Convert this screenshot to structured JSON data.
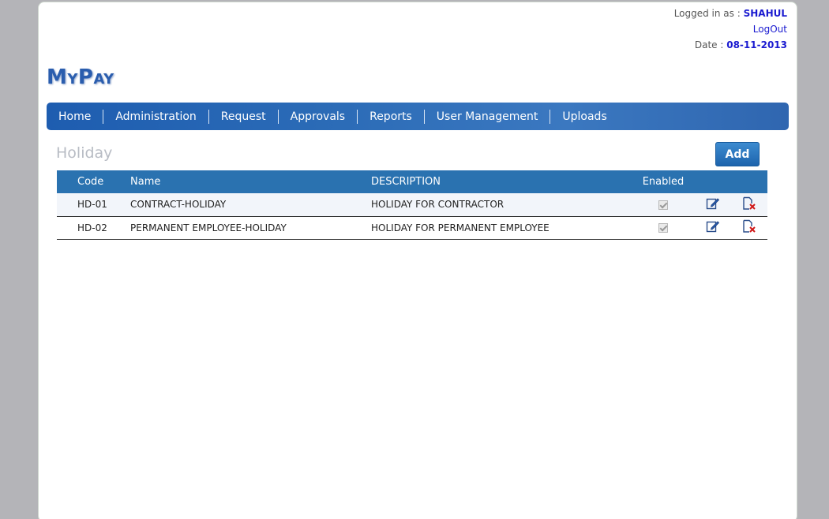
{
  "user": {
    "logged_in_label": "Logged in as : ",
    "username": "SHAHUL",
    "logout_label": "LogOut",
    "date_label": "Date : ",
    "date_value": "08-11-2013"
  },
  "brand": {
    "logo_text": "MyPay"
  },
  "nav": {
    "items": [
      "Home",
      "Administration",
      "Request",
      "Approvals",
      "Reports",
      "User Management",
      "Uploads"
    ]
  },
  "page": {
    "title": "Holiday",
    "add_label": "Add"
  },
  "table": {
    "headers": {
      "code": "Code",
      "name": "Name",
      "description": "DESCRIPTION",
      "enabled": "Enabled"
    },
    "rows": [
      {
        "code": "HD-01",
        "name": "CONTRACT-HOLIDAY",
        "description": "HOLIDAY FOR CONTRACTOR",
        "enabled": true
      },
      {
        "code": "HD-02",
        "name": "PERMANENT EMPLOYEE-HOLIDAY",
        "description": "HOLIDAY FOR PERMANENT EMPLOYEE",
        "enabled": true
      }
    ]
  },
  "icons": {
    "edit": "edit-icon",
    "delete": "delete-icon"
  },
  "colors": {
    "nav_blue": "#2c6cb7",
    "header_blue": "#2a72b0",
    "link_blue": "#1a1ad0"
  }
}
